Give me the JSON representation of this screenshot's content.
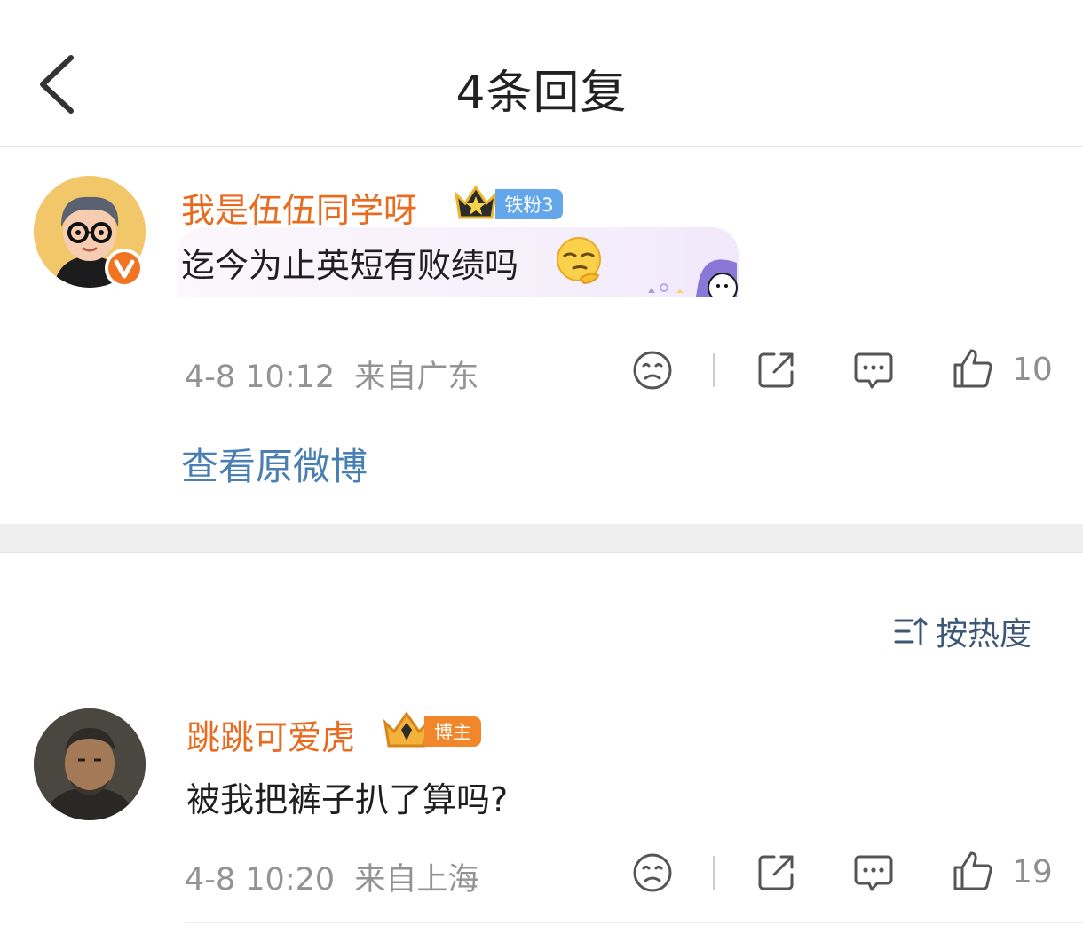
{
  "header": {
    "title": "4条回复",
    "back_icon": "chevron-left-icon"
  },
  "root_comment": {
    "username": "我是伍伍同学呀",
    "badge": "铁粉3",
    "content": "迄今为止英短有败绩吗",
    "emoji": "thinking-face-emoji",
    "time": "4-8 10:12",
    "location": "来自广东",
    "like_count": "10",
    "view_original": "查看原微博",
    "verified_icon": "verified-v-icon"
  },
  "sort": {
    "label": "按热度",
    "icon": "sort-icon"
  },
  "replies": [
    {
      "username": "跳跳可爱虎",
      "badge": "博主",
      "content": "被我把裤子扒了算吗?",
      "time": "4-8 10:20",
      "location": "来自上海",
      "like_count": "19"
    }
  ],
  "colors": {
    "username": "#e86b1f",
    "link": "#4a7fb4",
    "meta": "#939393",
    "fan_badge": "#63a7ea",
    "host_badge": "#f1862b"
  }
}
